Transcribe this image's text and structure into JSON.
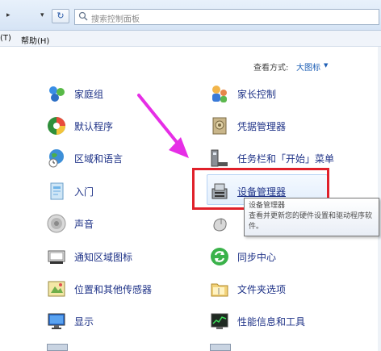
{
  "search": {
    "placeholder": "搜索控制面板"
  },
  "menu": {
    "partial_item": "(T)",
    "help": "帮助(H)"
  },
  "view_by": {
    "label": "查看方式:",
    "value": "大图标"
  },
  "items": {
    "homegroup": "家庭组",
    "parental": "家长控制",
    "default_programs": "默认程序",
    "credential": "凭据管理器",
    "region": "区域和语言",
    "taskbar": "任务栏和「开始」菜单",
    "getting_started": "入门",
    "device_manager": "设备管理器",
    "sound": "声音",
    "notification": "通知区域图标",
    "sync": "同步中心",
    "location": "位置和其他传感器",
    "folder": "文件夹选项",
    "display": "显示",
    "performance": "性能信息和工具"
  },
  "tooltip": {
    "title": "设备管理器",
    "body": "查看并更新您的硬件设置和驱动程序软件。"
  },
  "colors": {
    "highlight": "#e0202a",
    "arrow": "#e62ee6",
    "link": "#1e3287"
  }
}
